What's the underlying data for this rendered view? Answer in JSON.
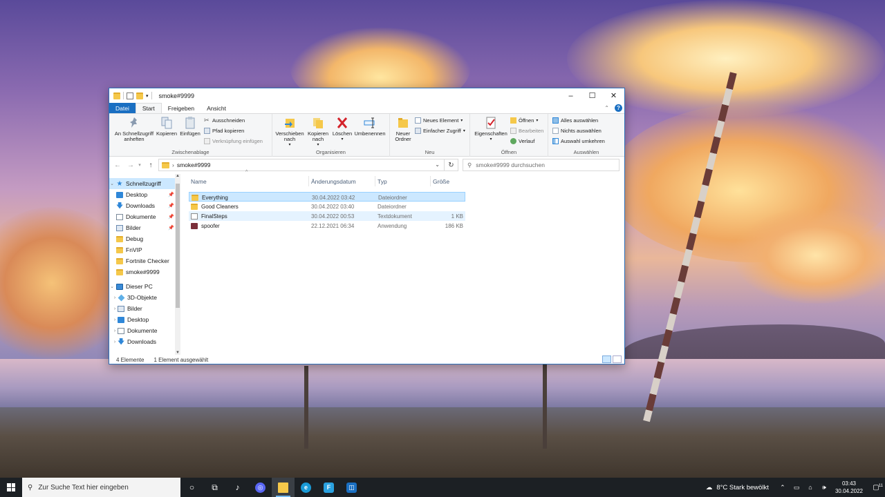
{
  "window": {
    "title": "smoke#9999",
    "controls": {
      "minimize": "–",
      "maximize": "☐",
      "close": "✕"
    }
  },
  "ribbon_tabs": [
    "Datei",
    "Start",
    "Freigeben",
    "Ansicht"
  ],
  "ribbon": {
    "clipboard": {
      "label": "Zwischenablage",
      "pin": "An Schnellzugriff anheften",
      "copy": "Kopieren",
      "paste": "Einfügen",
      "cut": "Ausschneiden",
      "copy_path": "Pfad kopieren",
      "paste_shortcut": "Verknüpfung einfügen"
    },
    "organize": {
      "label": "Organisieren",
      "move_to": "Verschieben nach",
      "copy_to": "Kopieren nach",
      "delete": "Löschen",
      "rename": "Umbenennen"
    },
    "new": {
      "label": "Neu",
      "new_folder": "Neuer Ordner",
      "new_item": "Neues Element",
      "easy_access": "Einfacher Zugriff"
    },
    "open": {
      "label": "Öffnen",
      "properties": "Eigenschaften",
      "open": "Öffnen",
      "edit": "Bearbeiten",
      "history": "Verlauf"
    },
    "select": {
      "label": "Auswählen",
      "select_all": "Alles auswählen",
      "select_none": "Nichts auswählen",
      "invert": "Auswahl umkehren"
    }
  },
  "address": {
    "path": "smoke#9999",
    "search_placeholder": "smoke#9999 durchsuchen"
  },
  "nav_pane": {
    "quick_access": "Schnellzugriff",
    "quick_items": [
      {
        "label": "Desktop",
        "icon": "desktop-icon",
        "pinned": true
      },
      {
        "label": "Downloads",
        "icon": "download-icon",
        "pinned": true
      },
      {
        "label": "Dokumente",
        "icon": "documents-icon",
        "pinned": true
      },
      {
        "label": "Bilder",
        "icon": "pictures-icon",
        "pinned": true
      },
      {
        "label": "Debug",
        "icon": "folder-icon",
        "pinned": false
      },
      {
        "label": "FnVIP",
        "icon": "folder-icon",
        "pinned": false
      },
      {
        "label": "Fortnite Checker",
        "icon": "folder-icon",
        "pinned": false
      },
      {
        "label": "smoke#9999",
        "icon": "folder-icon",
        "pinned": false
      }
    ],
    "this_pc": "Dieser PC",
    "pc_items": [
      {
        "label": "3D-Objekte",
        "icon": "3d-objects-icon"
      },
      {
        "label": "Bilder",
        "icon": "pictures-icon"
      },
      {
        "label": "Desktop",
        "icon": "desktop-icon"
      },
      {
        "label": "Dokumente",
        "icon": "documents-icon"
      },
      {
        "label": "Downloads",
        "icon": "download-icon"
      }
    ]
  },
  "columns": [
    "Name",
    "Änderungsdatum",
    "Typ",
    "Größe"
  ],
  "files": [
    {
      "name": "Everything",
      "date": "30.04.2022 03:42",
      "type": "Dateiordner",
      "size": "",
      "icon": "folder-icon",
      "state": "selected"
    },
    {
      "name": "Good Cleaners",
      "date": "30.04.2022 03:40",
      "type": "Dateiordner",
      "size": "",
      "icon": "folder-icon",
      "state": ""
    },
    {
      "name": "FinalSteps",
      "date": "30.04.2022 00:53",
      "type": "Textdokument",
      "size": "1 KB",
      "icon": "text-file-icon",
      "state": "hover"
    },
    {
      "name": "spoofer",
      "date": "22.12.2021 06:34",
      "type": "Anwendung",
      "size": "186 KB",
      "icon": "application-icon",
      "state": ""
    }
  ],
  "status": {
    "count": "4 Elemente",
    "selection": "1 Element ausgewählt"
  },
  "taskbar": {
    "search_placeholder": "Zur Suche Text hier eingeben",
    "weather": "8°C  Stark bewölkt",
    "time": "03:43",
    "date": "30.04.2022",
    "notifications": "11"
  },
  "colors": {
    "accent": "#1a6fc2",
    "selection": "#cce8ff",
    "folder": "#f5c84a",
    "taskbar": "#1c2024"
  }
}
